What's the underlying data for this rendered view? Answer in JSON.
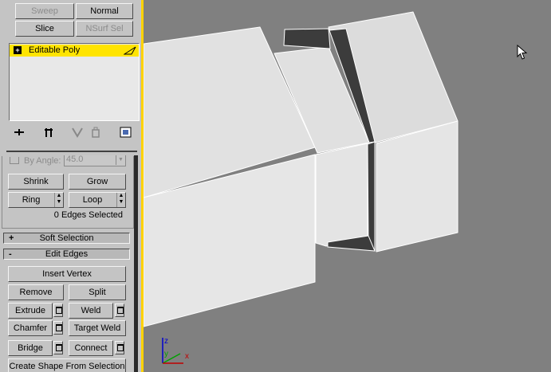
{
  "top_buttons": {
    "sweep": "Sweep",
    "normal": "Normal",
    "slice": "Slice",
    "nsurf_sel": "NSurf Sel"
  },
  "modifier_stack": {
    "item": "Editable Poly",
    "expand_glyph": "+"
  },
  "stack_toolbar": {
    "icons": [
      "pin-stack-icon",
      "show-end-result-icon",
      "make-unique-icon",
      "remove-modifier-icon",
      "configure-modifier-sets-icon"
    ]
  },
  "selection": {
    "by_angle_label": "By Angle:",
    "by_angle_value": "45.0",
    "shrink": "Shrink",
    "grow": "Grow",
    "ring": "Ring",
    "loop": "Loop",
    "status": "0 Edges Selected"
  },
  "soft_selection": {
    "sign": "+",
    "title": "Soft Selection"
  },
  "edit_edges": {
    "sign": "-",
    "title": "Edit Edges",
    "insert_vertex": "Insert Vertex",
    "remove": "Remove",
    "split": "Split",
    "extrude": "Extrude",
    "weld": "Weld",
    "chamfer": "Chamfer",
    "target_weld": "Target Weld",
    "bridge": "Bridge",
    "connect": "Connect",
    "create_shape": "Create Shape From Selection"
  },
  "viewport": {
    "axis_labels": {
      "x": "x",
      "y": "y",
      "z": "z"
    }
  },
  "colors": {
    "accent": "#ffd200",
    "panel": "#c4c4c4",
    "viewport": "#808080",
    "axis_x": "#c00000",
    "axis_y": "#00a000",
    "axis_z": "#0000d0"
  }
}
